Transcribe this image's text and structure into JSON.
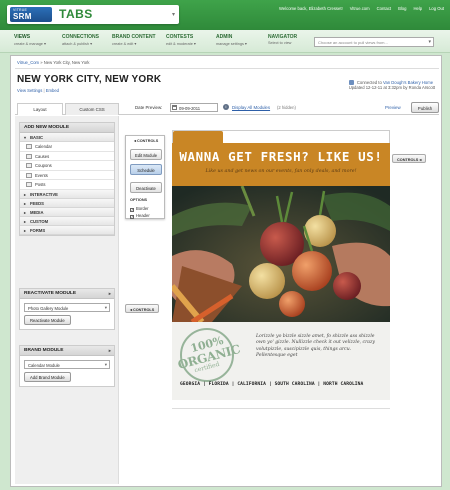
{
  "app": {
    "brand_small": "VITRUE",
    "brand": "SRM",
    "title": "TABS"
  },
  "top_links": [
    "Welcome back, Elizabeth Cresset!",
    "Vitrue.com",
    "Contact",
    "Blog",
    "Help",
    "Log Out"
  ],
  "nav": {
    "items": [
      {
        "label": "VIEWS",
        "sub": "create & manage ▾"
      },
      {
        "label": "CONNECTIONS",
        "sub": "attach & publish ▾"
      },
      {
        "label": "BRAND CONTENT",
        "sub": "create & edit ▾"
      },
      {
        "label": "CONTESTS",
        "sub": "edit & moderate ▾"
      },
      {
        "label": "ADMIN",
        "sub": "manage settings ▾"
      },
      {
        "label": "NAVIGATOR",
        "sub": "Select to view"
      }
    ],
    "search_placeholder": "Choose an account to pull views from..."
  },
  "breadcrumb": {
    "root": "Vitrue_Com",
    "sep": "»",
    "current": "New York City, New York"
  },
  "page": {
    "title": "NEW YORK CITY, NEW YORK",
    "link_view_settings": "View Settings",
    "link_sep": "|",
    "link_embed": "Embed",
    "connected_prefix": "Connected to",
    "connected_page": "Van Dough's Bakery Home",
    "updated": "Updated 12-12-11 at 3:32pm by Ronda Arscott"
  },
  "tabs": {
    "layout": "Layout",
    "custom_css": "Custom CSS"
  },
  "toolbar": {
    "date_label": "Date Preview:",
    "date_value": "09-09-2011",
    "display_all": "Display All Modules",
    "hidden_count": "(2 hidden)",
    "preview": "Preview",
    "publish": "Publish"
  },
  "sidebar": {
    "add_module_title": "ADD NEW MODULE",
    "basic_label": "BASIC",
    "basic_items": [
      "Calendar",
      "Causes",
      "Coupons",
      "Events",
      "Posts"
    ],
    "categories": [
      "INTERACTIVE",
      "FEEDS",
      "MEDIA",
      "CUSTOM",
      "FORMS"
    ],
    "reactivate": {
      "title": "REACTIVATE MODULE",
      "select": "Photo Gallery Module",
      "button": "Reactivate Module"
    },
    "brand": {
      "title": "BRAND MODULE",
      "select": "Calendar Module",
      "button": "Add Brand Module"
    }
  },
  "controls": {
    "label": "CONTROLS",
    "edit": "Edit Module",
    "schedule": "Schedule",
    "deactivate": "Deactivate",
    "options_label": "OPTIONS",
    "border": "Border",
    "header": "Header",
    "right_tab": "CONTROLS",
    "left_tab": "CONTROLS"
  },
  "module": {
    "headline": "WANNA GET FRESH?  LIKE US!",
    "subhead": "Like us and get news on our events, fan only deals, and more!",
    "stamp_pct": "100%",
    "stamp_org": "ORGANIC",
    "stamp_cert": "certified",
    "lorem": "Lorizzle yo bizzle sizzle amet, fo shizzle ass shizzle own yo' gizzle. Nullizzle check it out velizzle, crazy volutpizzle, suscipizzle quis, things arcu. Pellentesque eget",
    "states": "GEORGIA  |  FLORIDA  |  CALIFORNIA  |  SOUTH CAROLINA  |  NORTH CAROLINA"
  },
  "colors": {
    "brand_green": "#3fa34a",
    "banner": "#c98625",
    "link": "#2d5fa8"
  },
  "icons": [
    "calendar-icon",
    "causes-icon",
    "coupons-icon",
    "events-icon",
    "posts-icon",
    "info-icon",
    "connection-icon",
    "caret-down-icon"
  ]
}
